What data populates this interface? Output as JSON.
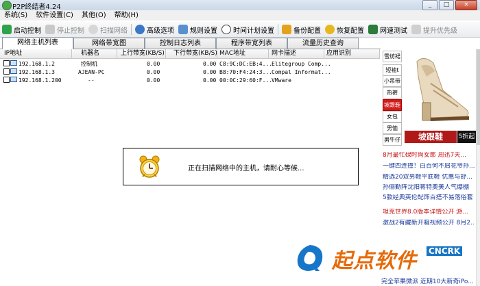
{
  "window": {
    "title": "P2P终结者4.24",
    "controls": [
      "_",
      "□",
      "×"
    ]
  },
  "menu": [
    "系统(S)",
    "软件设置(C)",
    "其他(O)",
    "帮助(H)"
  ],
  "toolbar": [
    {
      "label": "启动控制",
      "icon": "start-check-icon",
      "enabled": true
    },
    {
      "label": "停止控制",
      "icon": "stop-icon",
      "enabled": false
    },
    {
      "label": "扫描网络",
      "icon": "scan-search-icon",
      "enabled": false
    },
    {
      "label": "高级选项",
      "icon": "advanced-options-icon",
      "enabled": true
    },
    {
      "label": "规则设置",
      "icon": "rules-icon",
      "enabled": true
    },
    {
      "label": "时间计划设置",
      "icon": "clock-icon",
      "enabled": true
    },
    {
      "label": "备份配置",
      "icon": "backup-icon",
      "enabled": true
    },
    {
      "label": "恢复配置",
      "icon": "restore-icon",
      "enabled": true
    },
    {
      "label": "网速测试",
      "icon": "speed-test-icon",
      "enabled": true
    },
    {
      "label": "提升优先级",
      "icon": "priority-icon",
      "enabled": false
    }
  ],
  "tabs": [
    "网络主机列表",
    "网络带宽图",
    "控制日志列表",
    "程序带宽列表",
    "流量历史查询"
  ],
  "active_tab": 0,
  "table": {
    "columns": [
      "IP地址",
      "机器名",
      "上行带宽(KB/S)",
      "下行带宽(KB/S)",
      "MAC地址",
      "网卡描述",
      "应用识别"
    ],
    "rows": [
      [
        "192.168.1.2",
        "控制机",
        "0.00",
        "0.00",
        "C8:9C:DC:EB:4...",
        "Elitegroup Comp...",
        ""
      ],
      [
        "192.168.1.3",
        "AJEAN-PC",
        "0.00",
        "0.00",
        "B8:70:F4:24:3...",
        "Compal Informat...",
        ""
      ],
      [
        "192.168.1.200",
        "--",
        "0.00",
        "0.00",
        "00:0C:29:60:F...",
        "VMware",
        ""
      ]
    ]
  },
  "dialog": {
    "message": "正在扫描网络中的主机，请耐心等候...",
    "icon": "alarm-clock-icon"
  },
  "ad": {
    "categories": [
      "雪纺裙",
      "短袖t",
      "小吊带",
      "热裤",
      "坡跟鞋",
      "女包",
      "男恤",
      "男牛仔"
    ],
    "active_category": 4,
    "banner_text": "坡跟鞋",
    "banner_tag": "5折起",
    "news": [
      {
        "text": "8月最忙碌时尚女郎 周迅7天...",
        "color": "#c81414"
      },
      {
        "text": "一键四连撞！白百何不屑花爷孙...",
        "color": "#1b3a9a"
      },
      {
        "text": "精选20双男鞋平底鞋 优惠与舒...",
        "color": "#1b3a9a"
      },
      {
        "text": "孙俪勤阵沈阳蒋特奥美人气爆棚",
        "color": "#1b3a9a"
      },
      {
        "text": "5款经典英伦配饰百搭不易落俗套",
        "color": "#1b3a9a"
      },
      {
        "text": "坦克世界8.0版本详情公开 游...",
        "color": "#c81414"
      },
      {
        "text": "激战2有藏新开箱视频公开 8月2...",
        "color": "#1b3a9a"
      }
    ],
    "bottom_news": "完全苹果微派 近期10大新奇iPo..."
  },
  "watermark": {
    "text": "起点软件",
    "tag": "CNCRK"
  }
}
